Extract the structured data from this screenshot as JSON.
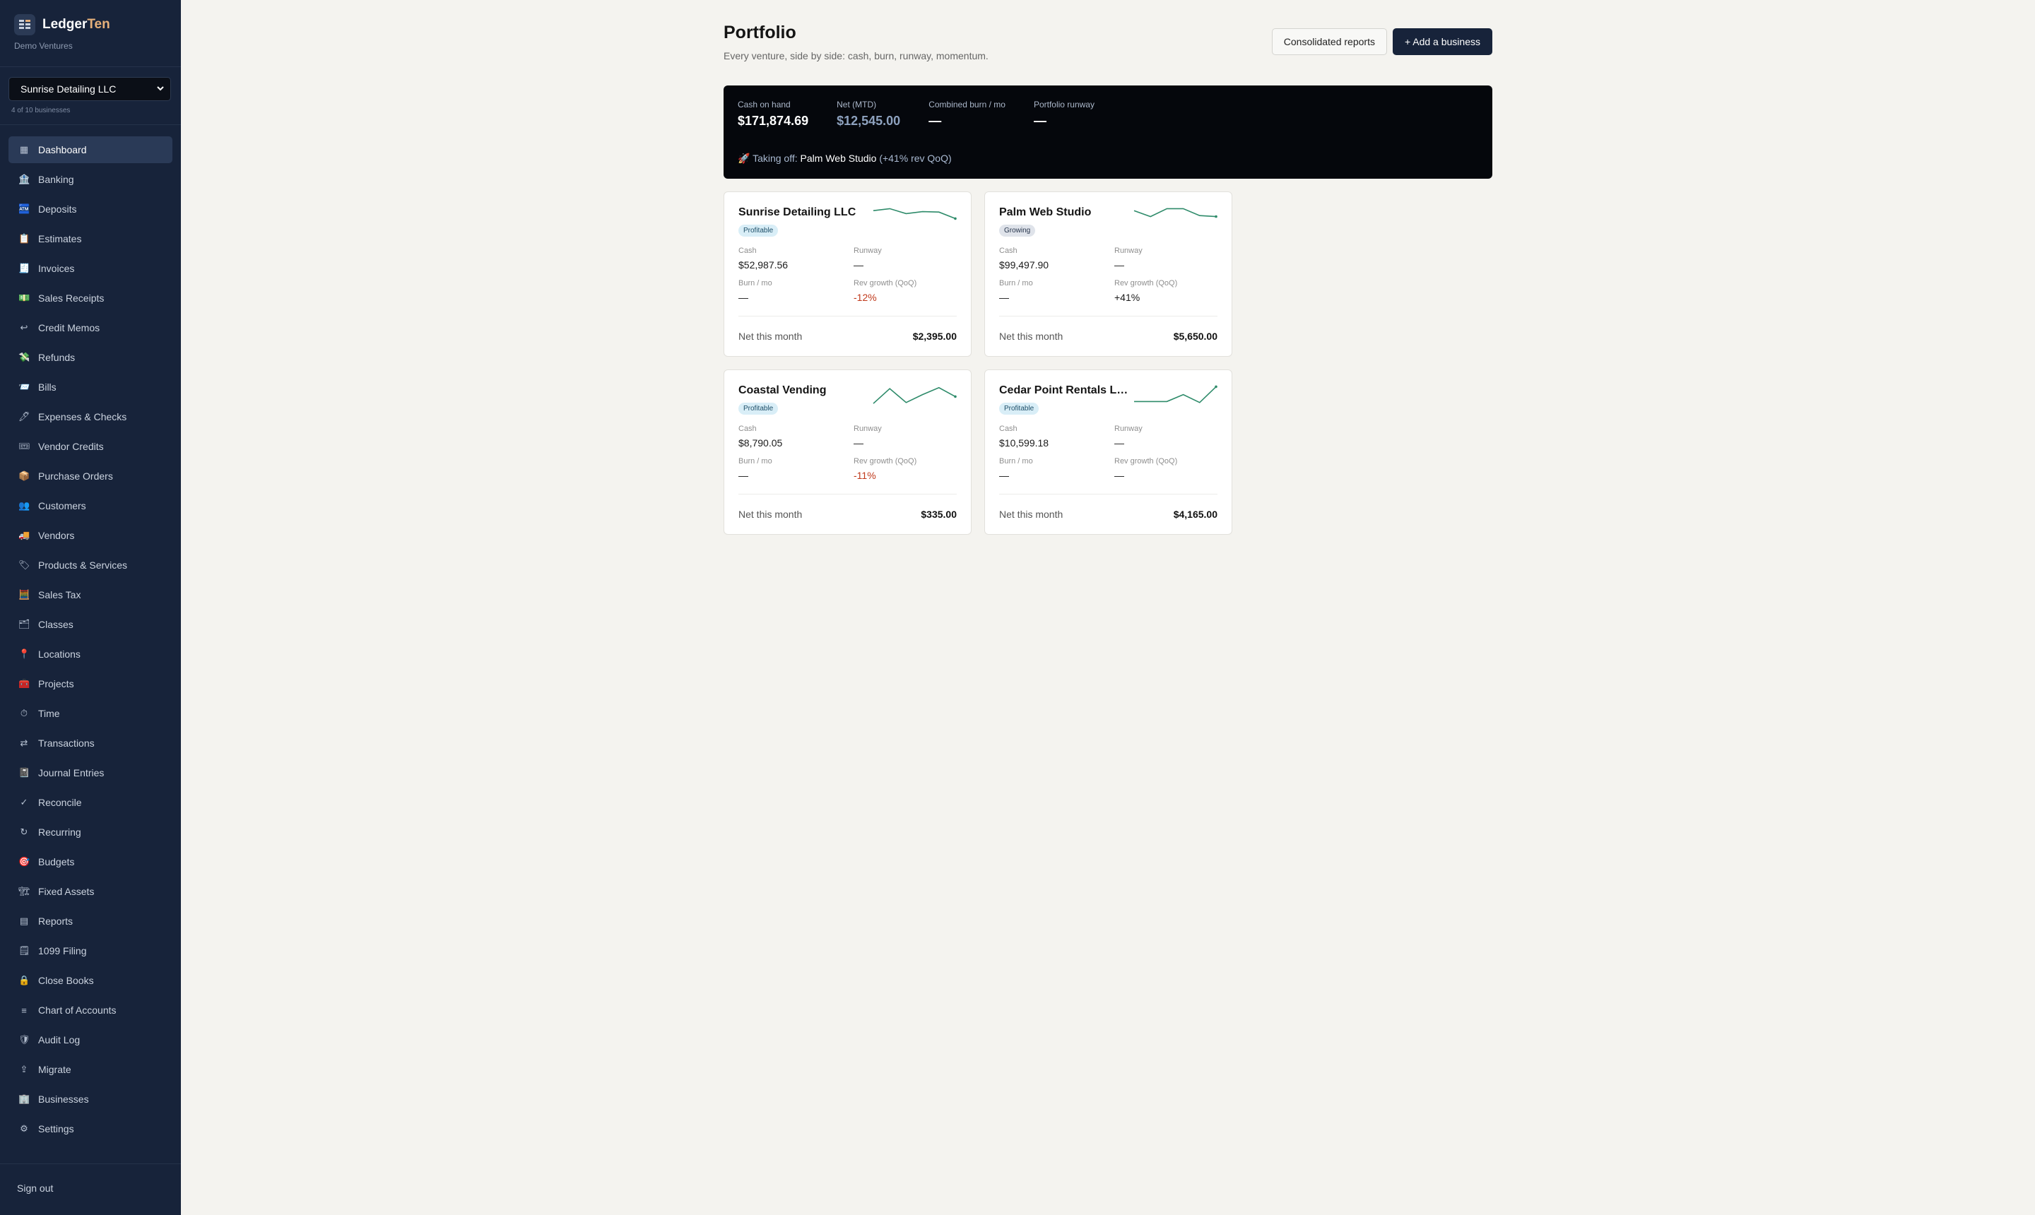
{
  "brand": {
    "name_primary": "Ledger",
    "name_accent": "Ten",
    "org": "Demo Ventures"
  },
  "business_switcher": {
    "selected": "Sunrise Detailing LLC",
    "count_text": "4 of 10 businesses"
  },
  "nav": [
    {
      "label": "Dashboard",
      "icon": "dashboard-icon",
      "glyph": "▦",
      "active": true
    },
    {
      "label": "Banking",
      "icon": "bank-icon",
      "glyph": "🏦"
    },
    {
      "label": "Deposits",
      "icon": "atm-icon",
      "glyph": "🏧"
    },
    {
      "label": "Estimates",
      "icon": "clipboard-icon",
      "glyph": "📋"
    },
    {
      "label": "Invoices",
      "icon": "receipt-icon",
      "glyph": "🧾"
    },
    {
      "label": "Sales Receipts",
      "icon": "cash-icon",
      "glyph": "💵"
    },
    {
      "label": "Credit Memos",
      "icon": "return-arrow-icon",
      "glyph": "↩"
    },
    {
      "label": "Refunds",
      "icon": "money-wings-icon",
      "glyph": "💸"
    },
    {
      "label": "Bills",
      "icon": "envelope-icon",
      "glyph": "📨"
    },
    {
      "label": "Expenses & Checks",
      "icon": "pen-icon",
      "glyph": "🖊"
    },
    {
      "label": "Vendor Credits",
      "icon": "ticket-icon",
      "glyph": "🎟"
    },
    {
      "label": "Purchase Orders",
      "icon": "package-icon",
      "glyph": "📦"
    },
    {
      "label": "Customers",
      "icon": "people-icon",
      "glyph": "👥"
    },
    {
      "label": "Vendors",
      "icon": "truck-icon",
      "glyph": "🚚"
    },
    {
      "label": "Products & Services",
      "icon": "tag-icon",
      "glyph": "🏷"
    },
    {
      "label": "Sales Tax",
      "icon": "abacus-icon",
      "glyph": "🧮"
    },
    {
      "label": "Classes",
      "icon": "folder-icon",
      "glyph": "🗂"
    },
    {
      "label": "Locations",
      "icon": "pin-icon",
      "glyph": "📍"
    },
    {
      "label": "Projects",
      "icon": "toolbox-icon",
      "glyph": "🧰"
    },
    {
      "label": "Time",
      "icon": "stopwatch-icon",
      "glyph": "⏱"
    },
    {
      "label": "Transactions",
      "icon": "swap-icon",
      "glyph": "⇄"
    },
    {
      "label": "Journal Entries",
      "icon": "notebook-icon",
      "glyph": "📓"
    },
    {
      "label": "Reconcile",
      "icon": "check-icon",
      "glyph": "✓"
    },
    {
      "label": "Recurring",
      "icon": "repeat-icon",
      "glyph": "↻"
    },
    {
      "label": "Budgets",
      "icon": "target-icon",
      "glyph": "🎯"
    },
    {
      "label": "Fixed Assets",
      "icon": "crane-icon",
      "glyph": "🏗"
    },
    {
      "label": "Reports",
      "icon": "report-icon",
      "glyph": "▤"
    },
    {
      "label": "1099 Filing",
      "icon": "document-icon",
      "glyph": "🗒"
    },
    {
      "label": "Close Books",
      "icon": "lock-icon",
      "glyph": "🔒"
    },
    {
      "label": "Chart of Accounts",
      "icon": "list-icon",
      "glyph": "≡"
    },
    {
      "label": "Audit Log",
      "icon": "shield-icon",
      "glyph": "🛡"
    },
    {
      "label": "Migrate",
      "icon": "upload-icon",
      "glyph": "⇪"
    },
    {
      "label": "Businesses",
      "icon": "building-icon",
      "glyph": "🏢"
    },
    {
      "label": "Settings",
      "icon": "gear-icon",
      "glyph": "⚙"
    }
  ],
  "sidebar_footer": {
    "signout": "Sign out"
  },
  "page": {
    "title": "Portfolio",
    "subtitle": "Every venture, side by side: cash, burn, runway, momentum.",
    "consolidated_reports": "Consolidated reports",
    "add_business": "+ Add a business"
  },
  "summary": {
    "metrics": [
      {
        "label": "Cash on hand",
        "value": "$171,874.69"
      },
      {
        "label": "Net (MTD)",
        "value": "$12,545.00"
      },
      {
        "label": "Combined burn / mo",
        "value": "—"
      },
      {
        "label": "Portfolio runway",
        "value": "—"
      }
    ],
    "takeoff_prefix": "🚀 Taking off:",
    "takeoff_business": "Palm Web Studio",
    "takeoff_detail": "(+41% rev QoQ)"
  },
  "colors": {
    "sparkline": "#2e8b6a",
    "negative": "#c0391b",
    "accent": "#e6b07a",
    "sidebar": "#17233a"
  },
  "cards": [
    {
      "name": "Sunrise Detailing LLC",
      "status": "Profitable",
      "cash_label": "Cash",
      "cash": "$52,987.56",
      "runway_label": "Runway",
      "runway": "—",
      "burn_label": "Burn / mo",
      "burn": "—",
      "growth_label": "Rev growth (QoQ)",
      "growth": "-12%",
      "net_label": "Net this month",
      "net": "$2,395.00",
      "trend": [
        0.85,
        0.95,
        0.7,
        0.8,
        0.78,
        0.45
      ]
    },
    {
      "name": "Palm Web Studio",
      "status": "Growing",
      "cash_label": "Cash",
      "cash": "$99,497.90",
      "runway_label": "Runway",
      "runway": "—",
      "burn_label": "Burn / mo",
      "burn": "—",
      "growth_label": "Rev growth (QoQ)",
      "growth": "+41%",
      "net_label": "Net this month",
      "net": "$5,650.00",
      "trend": [
        0.85,
        0.55,
        0.95,
        0.95,
        0.6,
        0.55
      ]
    },
    {
      "name": "Coastal Vending",
      "status": "Profitable",
      "cash_label": "Cash",
      "cash": "$8,790.05",
      "runway_label": "Runway",
      "runway": "—",
      "burn_label": "Burn / mo",
      "burn": "—",
      "growth_label": "Rev growth (QoQ)",
      "growth": "-11%",
      "net_label": "Net this month",
      "net": "$335.00",
      "trend": [
        0.1,
        0.85,
        0.15,
        0.55,
        0.9,
        0.45
      ]
    },
    {
      "name": "Cedar Point Rentals LLC",
      "status": "Profitable",
      "cash_label": "Cash",
      "cash": "$10,599.18",
      "runway_label": "Runway",
      "runway": "—",
      "burn_label": "Burn / mo",
      "burn": "—",
      "growth_label": "Rev growth (QoQ)",
      "growth": "—",
      "net_label": "Net this month",
      "net": "$4,165.00",
      "trend": [
        0.2,
        0.2,
        0.2,
        0.55,
        0.15,
        0.95
      ]
    }
  ]
}
